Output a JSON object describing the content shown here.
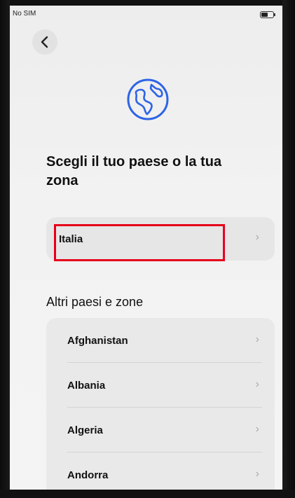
{
  "status_bar": {
    "carrier": "No SIM"
  },
  "title": "Scegli il tuo paese o la tua zona",
  "current_country": {
    "label": "Italia"
  },
  "section_title": "Altri paesi e zone",
  "countries": [
    {
      "label": "Afghanistan"
    },
    {
      "label": "Albania"
    },
    {
      "label": "Algeria"
    },
    {
      "label": "Andorra"
    }
  ],
  "chevron_glyph": "›",
  "colors": {
    "highlight": "#e6001a",
    "globe": "#2d63e6"
  },
  "icons": {
    "back": "chevron-left-icon",
    "globe": "globe-icon",
    "row": "chevron-right-icon"
  }
}
